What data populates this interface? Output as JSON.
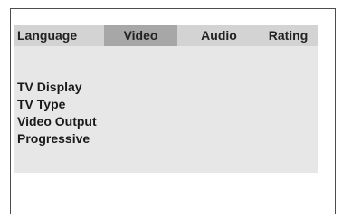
{
  "tabs": [
    {
      "label": "Language",
      "active": false
    },
    {
      "label": "Video",
      "active": true
    },
    {
      "label": "Audio",
      "active": false
    },
    {
      "label": "Rating",
      "active": false
    }
  ],
  "menu": {
    "items": [
      "TV Display",
      "TV Type",
      "Video Output",
      "Progressive"
    ]
  },
  "colors": {
    "tab_bar": "#d3d3d3",
    "active_tab": "#a7a7a7",
    "panel": "#e7e7e7",
    "frame_border": "#4d4d4d"
  }
}
